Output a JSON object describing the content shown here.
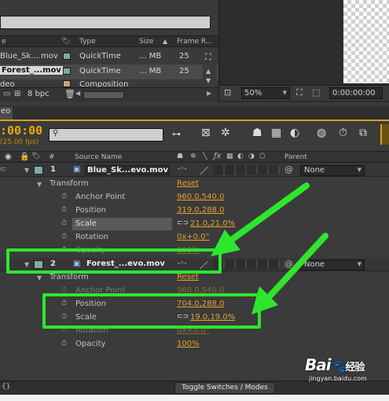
{
  "project": {
    "columns": {
      "type": "Type",
      "size": "Size",
      "frame_rate": "Frame R..."
    },
    "items": [
      {
        "name": "Blue_Sk....mov",
        "type": "QuickTime",
        "size": "... MB",
        "rate": "25",
        "swatch": "#7fa9a9"
      },
      {
        "name": "Forest_...mov",
        "type": "QuickTime",
        "size": "... MB",
        "rate": "25",
        "swatch": "#7fa9a9"
      },
      {
        "name": "deo",
        "type": "Composition",
        "size": "",
        "rate": "",
        "swatch": "#c4a56f"
      }
    ],
    "bpc": "8 bpc"
  },
  "viewer": {
    "zoom": "50%",
    "timecode": "0:00:00:00"
  },
  "timeline": {
    "tab_label": "eo",
    "current_time": ":00:00",
    "fps": "25.00 fps)",
    "columns": {
      "hash": "#",
      "source_name": "Source Name",
      "parent": "Parent"
    },
    "accent": "#d9a021",
    "layers": [
      {
        "number": "1",
        "name": "Blue_Sk...evo.mov",
        "parent": "None",
        "swatch": "#7fa9a9",
        "transform": "Transform",
        "reset": "Reset",
        "props": [
          {
            "name": "Anchor Point",
            "value": "960.0,540.0"
          },
          {
            "name": "Position",
            "value": "319.0,288.0"
          },
          {
            "name": "Scale",
            "value": "21.0,21.0%"
          },
          {
            "name": "Rotation",
            "value": "0x+0.0°"
          },
          {
            "name": "Opacity",
            "value": "100%"
          }
        ]
      },
      {
        "number": "2",
        "name": "Forest_...evo.mov",
        "parent": "None",
        "swatch": "#7fa9a9",
        "transform": "Transform",
        "reset": "Reset",
        "props": [
          {
            "name": "Anchor Point",
            "value": "960.0,540.0"
          },
          {
            "name": "Position",
            "value": "704.0,288.0"
          },
          {
            "name": "Scale",
            "value": "19.0,19.0%"
          },
          {
            "name": "Rotation",
            "value": "0x+0.0°"
          },
          {
            "name": "Opacity",
            "value": "100%"
          }
        ]
      }
    ],
    "toggle_label": "Toggle Switches / Modes"
  },
  "watermark": {
    "brand": "Bai",
    "brand2": "经验",
    "url": "jingyan.baidu.com"
  },
  "annotation_color": "#2ee62e"
}
